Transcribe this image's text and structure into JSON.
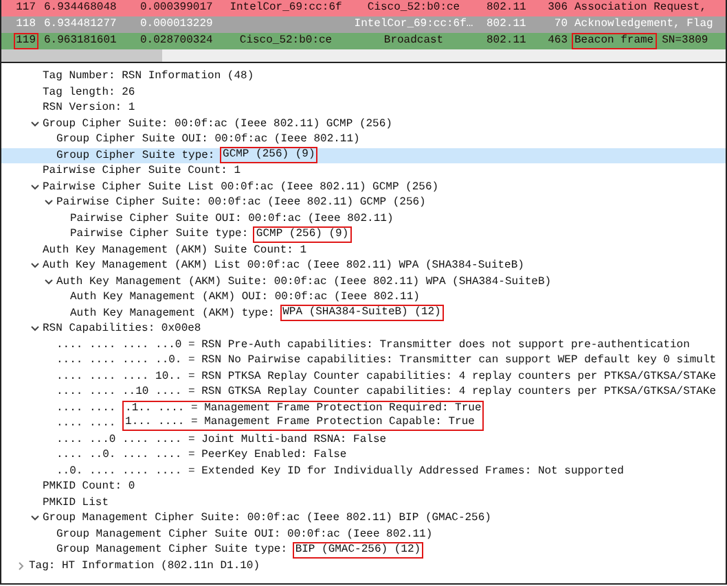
{
  "packet_list": {
    "rows": [
      {
        "color": "#f47c88",
        "kind": "dark",
        "selected": false,
        "cells": [
          {
            "text": "117",
            "boxed": false
          },
          {
            "text": "6.934468048",
            "boxed": false
          },
          {
            "text": "0.000399017",
            "boxed": false
          },
          {
            "text": "IntelCor_69:cc:6f",
            "boxed": false
          },
          {
            "text": "Cisco_52:b0:ce",
            "boxed": false
          },
          {
            "text": "802.11",
            "boxed": false
          },
          {
            "text": "306",
            "boxed": false
          },
          {
            "text": "Association Request,",
            "boxed": false
          }
        ]
      },
      {
        "color": "#a3a3a3",
        "kind": "light",
        "selected": false,
        "cells": [
          {
            "text": "118",
            "boxed": false
          },
          {
            "text": "6.934481277",
            "boxed": false
          },
          {
            "text": "0.000013229",
            "boxed": false
          },
          {
            "text": "",
            "boxed": false
          },
          {
            "text": "IntelCor_69:cc:6f…",
            "boxed": false
          },
          {
            "text": "802.11",
            "boxed": false
          },
          {
            "text": "70",
            "boxed": false
          },
          {
            "text": "Acknowledgement, Flag",
            "boxed": false
          }
        ]
      },
      {
        "color": "#6fab6f",
        "kind": "dark",
        "selected": false,
        "cells": [
          {
            "text": "119",
            "boxed": true
          },
          {
            "text": "6.963181601",
            "boxed": false
          },
          {
            "text": "0.028700324",
            "boxed": false
          },
          {
            "text": "Cisco_52:b0:ce",
            "boxed": false
          },
          {
            "text": "Broadcast",
            "boxed": false
          },
          {
            "text": "802.11",
            "boxed": false
          },
          {
            "text": "463",
            "boxed": false
          },
          {
            "text": "Beacon frame",
            "boxed": true
          },
          {
            "text": "SN=3809",
            "boxed": false
          }
        ]
      }
    ]
  },
  "details": {
    "continued_lines": [
      {
        "text": "Tag Number: RSN Information (48)",
        "selected": false
      },
      {
        "text": "Tag length: 26",
        "selected": false
      },
      {
        "text": "RSN Version: 1",
        "selected": false
      },
      {
        "text": "Group Cipher Suite: 00:0f:ac (Ieee 802.11) GCMP (256)",
        "selected": false,
        "expanded": true,
        "children": [
          {
            "text": "Group Cipher Suite OUI: 00:0f:ac (Ieee 802.11)",
            "selected": false
          },
          {
            "text": "Group Cipher Suite type: ",
            "value": "GCMP (256) (9)",
            "boxed": true,
            "selected": true
          }
        ]
      },
      {
        "text": "Pairwise Cipher Suite Count: 1",
        "selected": false
      },
      {
        "text": "Pairwise Cipher Suite List 00:0f:ac (Ieee 802.11) GCMP (256)",
        "selected": false,
        "expanded": true,
        "children": [
          {
            "text": "Pairwise Cipher Suite: 00:0f:ac (Ieee 802.11) GCMP (256)",
            "selected": false,
            "expanded": true,
            "children": [
              {
                "text": "Pairwise Cipher Suite OUI: 00:0f:ac (Ieee 802.11)",
                "selected": false
              },
              {
                "text": "Pairwise Cipher Suite type: ",
                "value": "GCMP (256) (9)",
                "boxed": true,
                "selected": false
              }
            ]
          }
        ]
      },
      {
        "text": "Auth Key Management (AKM) Suite Count: 1",
        "selected": false
      },
      {
        "text": "Auth Key Management (AKM) List 00:0f:ac (Ieee 802.11) WPA (SHA384-SuiteB)",
        "selected": false,
        "expanded": true,
        "children": [
          {
            "text": "Auth Key Management (AKM) Suite: 00:0f:ac (Ieee 802.11) WPA (SHA384-SuiteB)",
            "selected": false,
            "expanded": true,
            "children": [
              {
                "text": "Auth Key Management (AKM) OUI: 00:0f:ac (Ieee 802.11)",
                "selected": false
              },
              {
                "text": "Auth Key Management (AKM) type: ",
                "value": "WPA (SHA384-SuiteB) (12)",
                "boxed": true,
                "selected": false
              }
            ]
          }
        ]
      },
      {
        "text": "RSN Capabilities: 0x00e8",
        "selected": false,
        "expanded": true,
        "children": [
          {
            "text": ".... .... .... ...0 = RSN Pre-Auth capabilities: Transmitter does not support pre-authentication",
            "selected": false
          },
          {
            "text": ".... .... .... ..0. = RSN No Pairwise capabilities: Transmitter can support WEP default key 0 simult",
            "selected": false
          },
          {
            "text": ".... .... .... 10.. = RSN PTKSA Replay Counter capabilities: 4 replay counters per PTKSA/GTKSA/STAKe",
            "selected": false
          },
          {
            "text": ".... .... ..10 .... = RSN GTKSA Replay Counter capabilities: 4 replay counters per PTKSA/GTKSA/STAKe",
            "selected": false
          },
          {
            "text": ".... .... ",
            "value": ".1.. .... = Management Frame Protection Required: True",
            "boxed": true,
            "selected": false
          },
          {
            "text": ".... .... ",
            "value": "1... .... = Management Frame Protection Capable: True",
            "boxed": true,
            "selected": false
          },
          {
            "text": ".... ...0 .... .... = Joint Multi-band RSNA: False",
            "selected": false
          },
          {
            "text": ".... ..0. .... .... = PeerKey Enabled: False",
            "selected": false
          },
          {
            "text": "..0. .... .... .... = Extended Key ID for Individually Addressed Frames: Not supported",
            "selected": false
          }
        ]
      },
      {
        "text": "PMKID Count: 0",
        "selected": false
      },
      {
        "text": "PMKID List",
        "selected": false
      },
      {
        "text": "Group Management Cipher Suite: 00:0f:ac (Ieee 802.11) BIP (GMAC-256)",
        "selected": false,
        "expanded": true,
        "children": [
          {
            "text": "Group Management Cipher Suite OUI: 00:0f:ac (Ieee 802.11)",
            "selected": false
          },
          {
            "text": "Group Management Cipher Suite type: ",
            "value": "BIP (GMAC-256) (12)",
            "boxed": true,
            "selected": false
          }
        ]
      }
    ],
    "lines": [
      {
        "text": "Tag: HT Information (802.11n D1.10)",
        "selected": false,
        "expanded": false
      }
    ]
  }
}
